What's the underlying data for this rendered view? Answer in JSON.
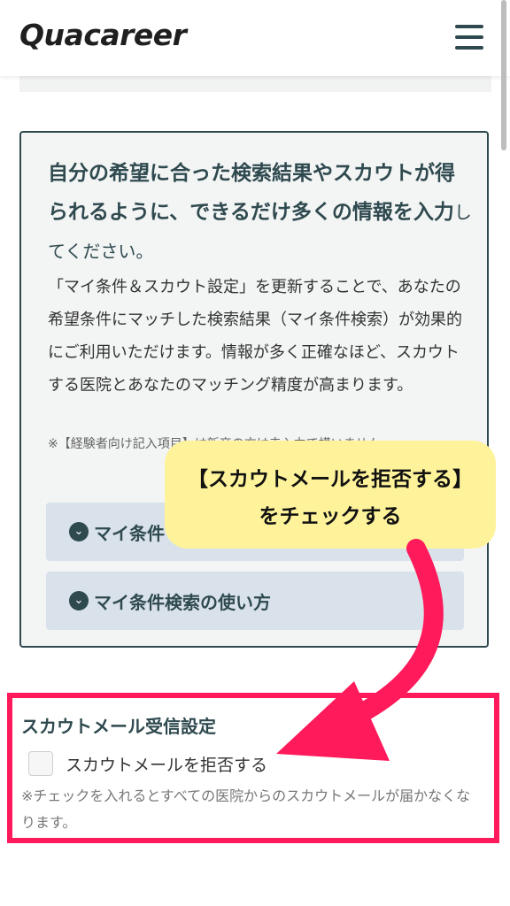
{
  "header": {
    "logo": "Quacareer",
    "menu_icon": "hamburger-menu-icon"
  },
  "info_box": {
    "heading": "自分の希望に合った検索結果やスカウトが得られるように、できるだけ多くの情報を入力",
    "heading_tail": "してください。",
    "body": "「マイ条件＆スカウト設定」を更新することで、あなたの希望条件にマッチした検索結果（マイ条件検索）が効果的にご利用いただけます。情報が多く正確なほど、スカウトする医院とあなたのマッチング精度が高まります。",
    "note": "※【経験者向け記入項目】は新卒の方は未入力で構いません。",
    "accordion_1": "マイ条件",
    "accordion_2": "マイ条件検索の使い方",
    "accordion_icon": "chevron-down-circle-icon"
  },
  "callout": {
    "line1": "【スカウトメールを拒否する】",
    "line2": "をチェックする",
    "accent_color": "#ff1a5b"
  },
  "scout_setting": {
    "title": "スカウトメール受信設定",
    "checkbox_label": "スカウトメールを拒否する",
    "checked": false,
    "note": "※チェックを入れるとすべての医院からのスカウトメールが届かなくなります。"
  }
}
